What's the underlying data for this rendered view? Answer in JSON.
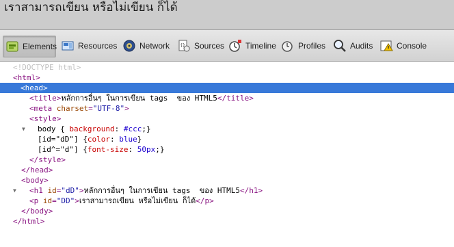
{
  "page": {
    "rendered_text": "เราสามารถเขียน หรือไม่เขียน ก็ได้"
  },
  "toolbar": {
    "tabs": [
      {
        "label": "Elements",
        "icon": "elements-icon",
        "active": true
      },
      {
        "label": "Resources",
        "icon": "resources-icon",
        "active": false
      },
      {
        "label": "Network",
        "icon": "network-icon",
        "active": false
      },
      {
        "label": "Sources",
        "icon": "sources-icon",
        "active": false
      },
      {
        "label": "Timeline",
        "icon": "timeline-icon",
        "active": false
      },
      {
        "label": "Profiles",
        "icon": "profiles-icon",
        "active": false
      },
      {
        "label": "Audits",
        "icon": "audits-icon",
        "active": false
      },
      {
        "label": "Console",
        "icon": "console-icon",
        "active": false
      }
    ]
  },
  "dom": {
    "doctype": "<!DOCTYPE html>",
    "html_open": "<html>",
    "head_open": "<head>",
    "title_open": "<title>",
    "title_text": "หลักการอื่นๆ ในการเขียน tags  ของ HTML5",
    "title_close": "</title>",
    "meta_open": "<meta",
    "meta_attr": "charset",
    "meta_eq": "=",
    "meta_val": "\"UTF-8\"",
    "meta_end": ">",
    "style_open": "<style>",
    "css": [
      {
        "selector": "body { ",
        "prop": "background",
        "value": "#ccc",
        "tail": ";}"
      },
      {
        "selector": "[id=\"dD\"] {",
        "prop": "color",
        "value": "blue",
        "tail": "}"
      },
      {
        "selector": "[id^=\"d\"] {",
        "prop": "font-size",
        "value": "50px",
        "tail": ";}"
      }
    ],
    "style_close": "</style>",
    "head_close": "</head>",
    "body_open": "<body>",
    "h1_open": "<h1",
    "h1_attr": "id",
    "h1_val": "\"dD\"",
    "h1_text": "หลักการอื่นๆ ในการเขียน tags  ของ HTML5",
    "h1_close": "</h1>",
    "p_open": "<p",
    "p_attr": "id",
    "p_val": "\"DD\"",
    "p_text": "เราสามารถเขียน หรือไม่เขียน ก็ได้",
    "p_close": "</p>",
    "body_close": "</body>",
    "html_close": "</html>"
  }
}
